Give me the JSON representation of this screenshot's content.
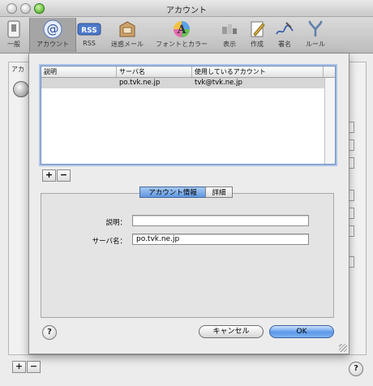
{
  "window": {
    "title": "アカウント"
  },
  "toolbar": {
    "items": [
      {
        "label": "一般",
        "icon": "switch-icon"
      },
      {
        "label": "アカウント",
        "icon": "at-sign-icon"
      },
      {
        "label": "RSS",
        "icon": "rss-icon"
      },
      {
        "label": "迷惑メール",
        "icon": "junk-mail-icon"
      },
      {
        "label": "フォントとカラー",
        "icon": "font-color-icon"
      },
      {
        "label": "表示",
        "icon": "view-icon"
      },
      {
        "label": "作成",
        "icon": "compose-icon"
      },
      {
        "label": "署名",
        "icon": "signature-icon"
      },
      {
        "label": "ルール",
        "icon": "rules-icon"
      }
    ]
  },
  "background": {
    "accounts_label": "アカ"
  },
  "sheet": {
    "table": {
      "columns": [
        "説明",
        "サーバ名",
        "使用しているアカウント"
      ],
      "rows": [
        {
          "description": "",
          "server": "po.tvk.ne.jp",
          "account": "tvk@tvk.ne.jp"
        }
      ]
    },
    "add_label": "+",
    "remove_label": "−",
    "tabs": {
      "info": "アカウント情報",
      "detail": "詳細"
    },
    "form": {
      "description_label": "説明：",
      "description_value": "",
      "server_label": "サーバ名：",
      "server_value": "po.tvk.ne.jp"
    },
    "help_label": "?",
    "cancel_label": "キャンセル",
    "ok_label": "OK"
  },
  "footer": {
    "add_label": "+",
    "remove_label": "−",
    "help_label": "?"
  }
}
